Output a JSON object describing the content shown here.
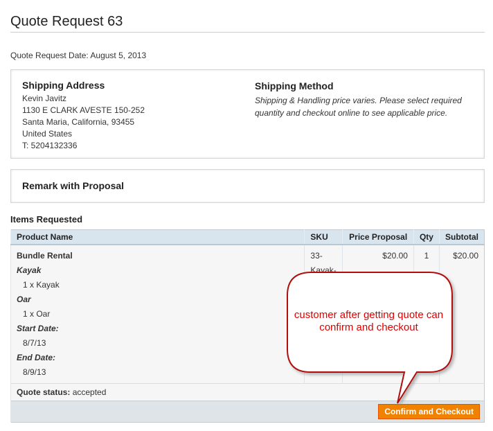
{
  "page_title": "Quote Request 63",
  "request_date": "Quote Request Date: August 5, 2013",
  "shipping_address": {
    "heading": "Shipping Address",
    "lines": [
      "Kevin Javitz",
      "1130 E CLARK AVESTE 150-252",
      "Santa Maria, California, 93455",
      "United States",
      "T: 5204132336"
    ]
  },
  "shipping_method": {
    "heading": "Shipping Method",
    "text": "Shipping & Handling price varies. Please select required quantity and checkout online to see applicable price."
  },
  "remark": {
    "heading": "Remark with Proposal"
  },
  "items": {
    "title": "Items Requested",
    "columns": [
      "Product Name",
      "SKU",
      "Price Proposal",
      "Qty",
      "Subtotal"
    ],
    "row": {
      "name": "Bundle Rental",
      "sku": "33-\nKayak-",
      "price": "$20.00",
      "qty": "1",
      "subtotal": "$20.00",
      "options": [
        {
          "label": "Kayak",
          "value": "1 x Kayak"
        },
        {
          "label": "Oar",
          "value": "1 x Oar"
        },
        {
          "label": "Start Date:",
          "value": "8/7/13"
        },
        {
          "label": "End Date:",
          "value": "8/9/13"
        }
      ]
    },
    "status_label": "Quote status:",
    "status_value": "accepted",
    "confirm_button": "Confirm and Checkout"
  },
  "callout": {
    "text": "customer after getting quote can confirm and checkout"
  }
}
